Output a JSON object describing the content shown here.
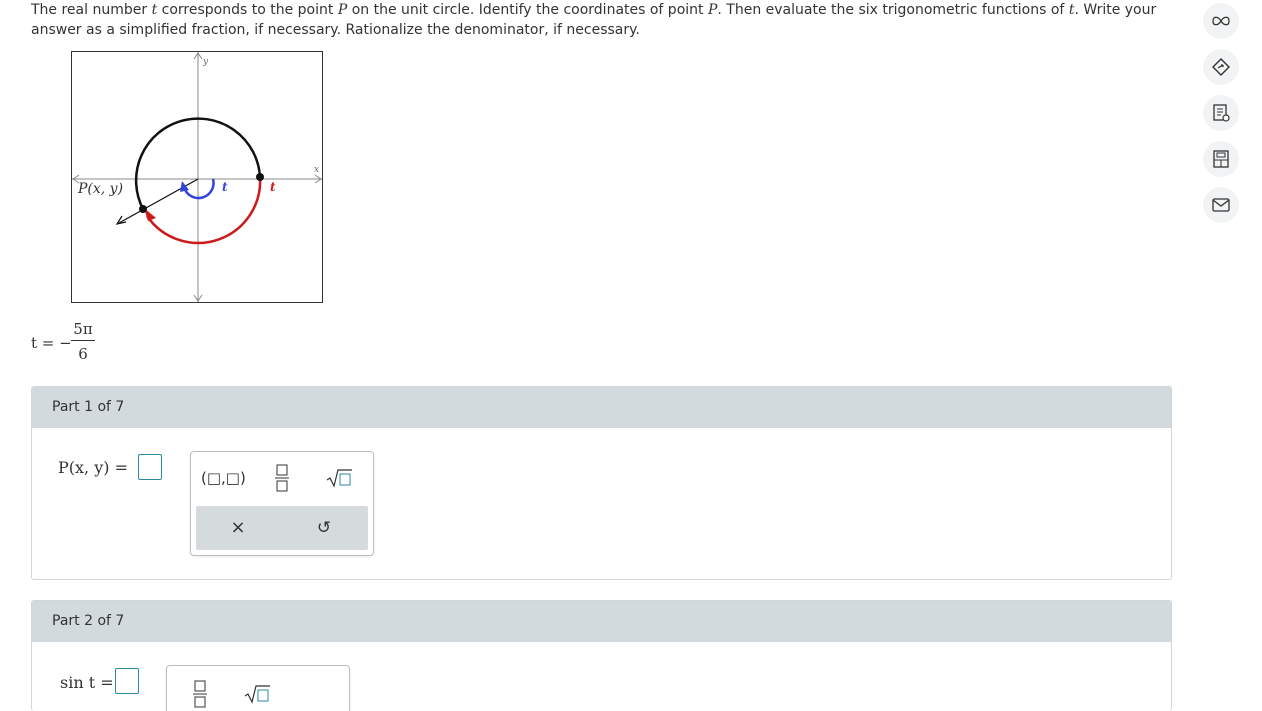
{
  "prompt": {
    "part1": "The real number",
    "var_t": "t",
    "part2": "corresponds to the point",
    "var_P": "P",
    "part3": "on the unit circle. Identify the coordinates of point",
    "var_P2": "P",
    "part4": ". Then evaluate the six trigonometric functions of",
    "var_t2": "t",
    "part5": ". Write your answer as a simplified fraction, if necessary. Rationalize the denominator, if necessary."
  },
  "figure": {
    "axis_x": "x",
    "axis_y": "y",
    "point_label": "P(x, y)",
    "angle_label_inner": "t",
    "angle_label_outer": "t"
  },
  "given": {
    "lhs": "t = −",
    "numerator": "5π",
    "denominator": "6"
  },
  "parts": [
    {
      "header": "Part 1 of 7",
      "label": "P(x, y) =",
      "palette": [
        "(□,□)",
        "fraction",
        "sqrt"
      ],
      "clear": "×",
      "undo": "↺"
    },
    {
      "header": "Part 2 of 7",
      "label": "sin t =",
      "palette": [
        "fraction",
        "sqrt"
      ]
    }
  ],
  "sidebar_icons": [
    "infinity-icon",
    "tag-icon",
    "document-icon",
    "calculator-icon",
    "mail-icon"
  ],
  "colors": {
    "accent": "#2a8b9f",
    "arc_red": "#cc1a1a",
    "arc_blue": "#3344dd",
    "header_bg": "#d3dade"
  }
}
